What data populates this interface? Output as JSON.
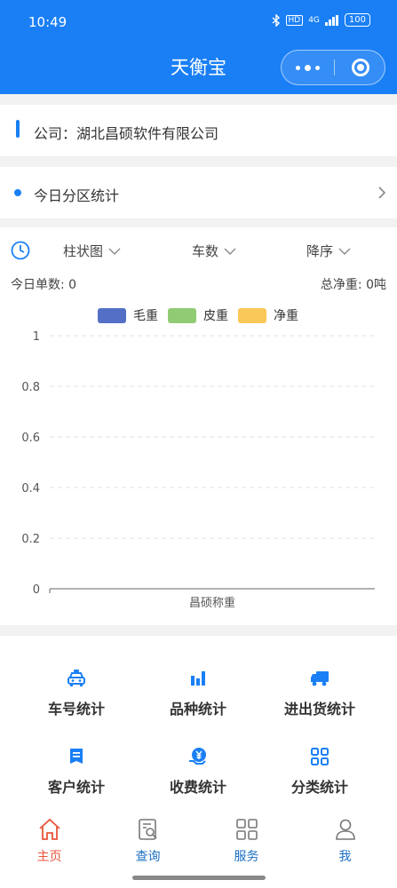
{
  "status_bar": {
    "time": "10:49",
    "network_label": "HD",
    "signal_label": "4G",
    "battery": "100"
  },
  "header": {
    "title": "天衡宝"
  },
  "company": {
    "label": "公司：湖北昌硕软件有限公司"
  },
  "zone": {
    "label": "今日分区统计"
  },
  "chart_controls": {
    "chart_type": "柱状图",
    "metric": "车数",
    "sort": "降序",
    "orders_today": "今日单数: 0",
    "total_net_weight": "总净重: 0吨"
  },
  "colors": {
    "accent": "#1a7ff5",
    "series_gross": "#5470c6",
    "series_tare": "#91cc75",
    "series_net": "#fac858"
  },
  "chart_data": {
    "type": "bar",
    "categories": [
      "昌硕称重"
    ],
    "series": [
      {
        "name": "毛重",
        "values": [
          0
        ]
      },
      {
        "name": "皮重",
        "values": [
          0
        ]
      },
      {
        "name": "净重",
        "values": [
          0
        ]
      }
    ],
    "yticks": [
      "0",
      "0.2",
      "0.4",
      "0.6",
      "0.8",
      "1"
    ],
    "ylim": [
      0,
      1
    ],
    "grid": true,
    "legend_position": "top-center"
  },
  "menu": [
    {
      "label": "车号统计",
      "icon": "taxi-icon"
    },
    {
      "label": "品种统计",
      "icon": "bar-chart-icon"
    },
    {
      "label": "进出货统计",
      "icon": "truck-icon"
    },
    {
      "label": "客户统计",
      "icon": "document-icon"
    },
    {
      "label": "收费统计",
      "icon": "yuan-icon"
    },
    {
      "label": "分类统计",
      "icon": "grid-icon"
    }
  ],
  "tabs": [
    {
      "label": "主页",
      "icon": "home-icon",
      "active": true
    },
    {
      "label": "查询",
      "icon": "search-icon",
      "active": false
    },
    {
      "label": "服务",
      "icon": "grid-icon",
      "active": false
    },
    {
      "label": "我",
      "icon": "user-icon",
      "active": false
    }
  ]
}
